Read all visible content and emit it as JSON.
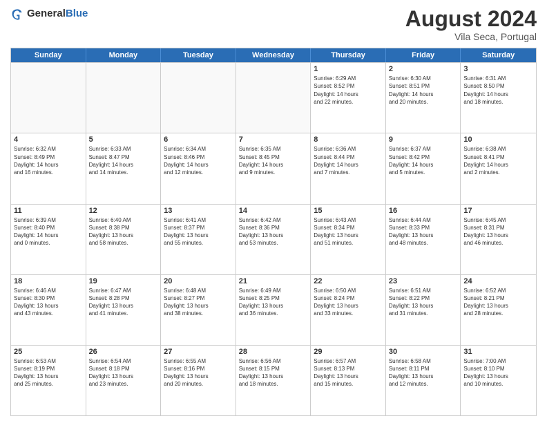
{
  "header": {
    "logo_general": "General",
    "logo_blue": "Blue",
    "month_title": "August 2024",
    "location": "Vila Seca, Portugal"
  },
  "days_of_week": [
    "Sunday",
    "Monday",
    "Tuesday",
    "Wednesday",
    "Thursday",
    "Friday",
    "Saturday"
  ],
  "weeks": [
    [
      {
        "day": "",
        "text": "",
        "empty": true
      },
      {
        "day": "",
        "text": "",
        "empty": true
      },
      {
        "day": "",
        "text": "",
        "empty": true
      },
      {
        "day": "",
        "text": "",
        "empty": true
      },
      {
        "day": "1",
        "text": "Sunrise: 6:29 AM\nSunset: 8:52 PM\nDaylight: 14 hours\nand 22 minutes."
      },
      {
        "day": "2",
        "text": "Sunrise: 6:30 AM\nSunset: 8:51 PM\nDaylight: 14 hours\nand 20 minutes."
      },
      {
        "day": "3",
        "text": "Sunrise: 6:31 AM\nSunset: 8:50 PM\nDaylight: 14 hours\nand 18 minutes."
      }
    ],
    [
      {
        "day": "4",
        "text": "Sunrise: 6:32 AM\nSunset: 8:49 PM\nDaylight: 14 hours\nand 16 minutes."
      },
      {
        "day": "5",
        "text": "Sunrise: 6:33 AM\nSunset: 8:47 PM\nDaylight: 14 hours\nand 14 minutes."
      },
      {
        "day": "6",
        "text": "Sunrise: 6:34 AM\nSunset: 8:46 PM\nDaylight: 14 hours\nand 12 minutes."
      },
      {
        "day": "7",
        "text": "Sunrise: 6:35 AM\nSunset: 8:45 PM\nDaylight: 14 hours\nand 9 minutes."
      },
      {
        "day": "8",
        "text": "Sunrise: 6:36 AM\nSunset: 8:44 PM\nDaylight: 14 hours\nand 7 minutes."
      },
      {
        "day": "9",
        "text": "Sunrise: 6:37 AM\nSunset: 8:42 PM\nDaylight: 14 hours\nand 5 minutes."
      },
      {
        "day": "10",
        "text": "Sunrise: 6:38 AM\nSunset: 8:41 PM\nDaylight: 14 hours\nand 2 minutes."
      }
    ],
    [
      {
        "day": "11",
        "text": "Sunrise: 6:39 AM\nSunset: 8:40 PM\nDaylight: 14 hours\nand 0 minutes."
      },
      {
        "day": "12",
        "text": "Sunrise: 6:40 AM\nSunset: 8:38 PM\nDaylight: 13 hours\nand 58 minutes."
      },
      {
        "day": "13",
        "text": "Sunrise: 6:41 AM\nSunset: 8:37 PM\nDaylight: 13 hours\nand 55 minutes."
      },
      {
        "day": "14",
        "text": "Sunrise: 6:42 AM\nSunset: 8:36 PM\nDaylight: 13 hours\nand 53 minutes."
      },
      {
        "day": "15",
        "text": "Sunrise: 6:43 AM\nSunset: 8:34 PM\nDaylight: 13 hours\nand 51 minutes."
      },
      {
        "day": "16",
        "text": "Sunrise: 6:44 AM\nSunset: 8:33 PM\nDaylight: 13 hours\nand 48 minutes."
      },
      {
        "day": "17",
        "text": "Sunrise: 6:45 AM\nSunset: 8:31 PM\nDaylight: 13 hours\nand 46 minutes."
      }
    ],
    [
      {
        "day": "18",
        "text": "Sunrise: 6:46 AM\nSunset: 8:30 PM\nDaylight: 13 hours\nand 43 minutes."
      },
      {
        "day": "19",
        "text": "Sunrise: 6:47 AM\nSunset: 8:28 PM\nDaylight: 13 hours\nand 41 minutes."
      },
      {
        "day": "20",
        "text": "Sunrise: 6:48 AM\nSunset: 8:27 PM\nDaylight: 13 hours\nand 38 minutes."
      },
      {
        "day": "21",
        "text": "Sunrise: 6:49 AM\nSunset: 8:25 PM\nDaylight: 13 hours\nand 36 minutes."
      },
      {
        "day": "22",
        "text": "Sunrise: 6:50 AM\nSunset: 8:24 PM\nDaylight: 13 hours\nand 33 minutes."
      },
      {
        "day": "23",
        "text": "Sunrise: 6:51 AM\nSunset: 8:22 PM\nDaylight: 13 hours\nand 31 minutes."
      },
      {
        "day": "24",
        "text": "Sunrise: 6:52 AM\nSunset: 8:21 PM\nDaylight: 13 hours\nand 28 minutes."
      }
    ],
    [
      {
        "day": "25",
        "text": "Sunrise: 6:53 AM\nSunset: 8:19 PM\nDaylight: 13 hours\nand 25 minutes."
      },
      {
        "day": "26",
        "text": "Sunrise: 6:54 AM\nSunset: 8:18 PM\nDaylight: 13 hours\nand 23 minutes."
      },
      {
        "day": "27",
        "text": "Sunrise: 6:55 AM\nSunset: 8:16 PM\nDaylight: 13 hours\nand 20 minutes."
      },
      {
        "day": "28",
        "text": "Sunrise: 6:56 AM\nSunset: 8:15 PM\nDaylight: 13 hours\nand 18 minutes."
      },
      {
        "day": "29",
        "text": "Sunrise: 6:57 AM\nSunset: 8:13 PM\nDaylight: 13 hours\nand 15 minutes."
      },
      {
        "day": "30",
        "text": "Sunrise: 6:58 AM\nSunset: 8:11 PM\nDaylight: 13 hours\nand 12 minutes."
      },
      {
        "day": "31",
        "text": "Sunrise: 7:00 AM\nSunset: 8:10 PM\nDaylight: 13 hours\nand 10 minutes."
      }
    ]
  ]
}
